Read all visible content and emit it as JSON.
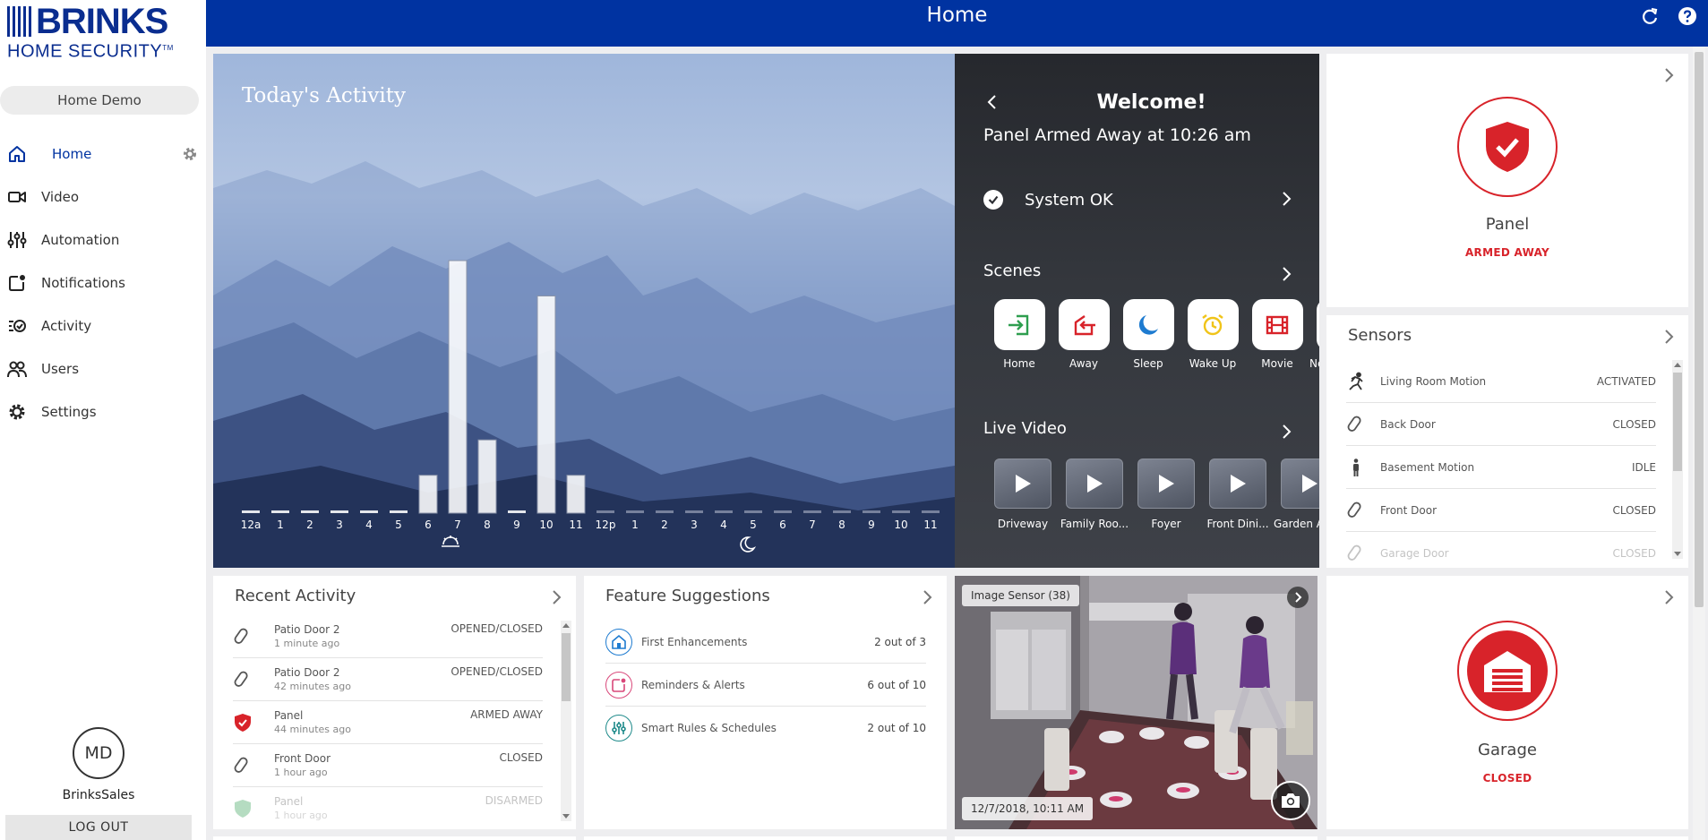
{
  "brand": {
    "line1": "BRINKS",
    "line2": "HOME SECURITY",
    "tm": "TM"
  },
  "account": "Home Demo",
  "nav": [
    {
      "label": "Home",
      "icon": "home-icon"
    },
    {
      "label": "Video",
      "icon": "video-camera-icon"
    },
    {
      "label": "Automation",
      "icon": "sliders-icon"
    },
    {
      "label": "Notifications",
      "icon": "notification-icon"
    },
    {
      "label": "Activity",
      "icon": "activity-icon"
    },
    {
      "label": "Users",
      "icon": "users-icon"
    },
    {
      "label": "Settings",
      "icon": "gear-icon"
    }
  ],
  "user": {
    "initials": "MD",
    "name": "BrinksSales",
    "logout": "LOG OUT"
  },
  "header": {
    "title": "Home"
  },
  "activity": {
    "title": "Today's Activity",
    "hours": [
      "12a",
      "1",
      "2",
      "3",
      "4",
      "5",
      "6",
      "7",
      "8",
      "9",
      "10",
      "11",
      "12p",
      "1",
      "2",
      "3",
      "4",
      "5",
      "6",
      "7",
      "8",
      "9",
      "10",
      "11"
    ],
    "levels": [
      0.01,
      0.01,
      0.01,
      0.01,
      0.01,
      0.01,
      0.15,
      1.0,
      0.29,
      0.01,
      0.86,
      0.15,
      0,
      0,
      0,
      0,
      0,
      0,
      0,
      0,
      0,
      0,
      0,
      0
    ],
    "current_hour_index": 11,
    "sunrise_icon": "sunrise-icon",
    "moon_icon": "moon-icon"
  },
  "welcome": {
    "title": "Welcome!",
    "subtitle": "Panel Armed Away at 10:26 am",
    "system": "System OK",
    "scenes_title": "Scenes",
    "scenes": [
      {
        "label": "Home",
        "icon": "arrive-home-icon",
        "color": "#2e9e4f"
      },
      {
        "label": "Away",
        "icon": "leave-home-icon",
        "color": "#d8232a"
      },
      {
        "label": "Sleep",
        "icon": "moon-icon",
        "color": "#1e7bd0"
      },
      {
        "label": "Wake Up",
        "icon": "alarm-clock-icon",
        "color": "#f0c419"
      },
      {
        "label": "Movie",
        "icon": "film-icon",
        "color": "#d8232a"
      },
      {
        "label": "Ne",
        "icon": "scene-icon",
        "color": "#888888"
      }
    ],
    "video_title": "Live Video",
    "videos": [
      "Driveway",
      "Family Roo...",
      "Foyer",
      "Front Dini...",
      "Garden A"
    ]
  },
  "panel": {
    "name": "Panel",
    "status": "ARMED AWAY"
  },
  "sensors": {
    "title": "Sensors",
    "items": [
      {
        "name": "Living Room Motion",
        "status": "ACTIVATED",
        "icon": "running-person-icon"
      },
      {
        "name": "Back Door",
        "status": "CLOSED",
        "icon": "contact-sensor-icon"
      },
      {
        "name": "Basement Motion",
        "status": "IDLE",
        "icon": "standing-person-icon"
      },
      {
        "name": "Front Door",
        "status": "CLOSED",
        "icon": "contact-sensor-icon"
      },
      {
        "name": "Garage Door",
        "status": "CLOSED",
        "icon": "contact-sensor-icon"
      }
    ]
  },
  "recent": {
    "title": "Recent Activity",
    "items": [
      {
        "name": "Patio Door 2",
        "time": "1 minute ago",
        "status": "OPENED/CLOSED",
        "icon": "contact-sensor-icon"
      },
      {
        "name": "Patio Door 2",
        "time": "42 minutes ago",
        "status": "OPENED/CLOSED",
        "icon": "contact-sensor-icon"
      },
      {
        "name": "Panel",
        "time": "44 minutes ago",
        "status": "ARMED AWAY",
        "icon": "shield-armed-icon"
      },
      {
        "name": "Front Door",
        "time": "1 hour ago",
        "status": "CLOSED",
        "icon": "contact-sensor-icon"
      },
      {
        "name": "Panel",
        "time": "1 hour ago",
        "status": "DISARMED",
        "icon": "shield-disarmed-icon"
      }
    ]
  },
  "features": {
    "title": "Feature Suggestions",
    "items": [
      {
        "name": "First Enhancements",
        "progress": "2 out of 3",
        "icon": "house-enhance-icon",
        "color": "#1e7bd0"
      },
      {
        "name": "Reminders & Alerts",
        "progress": "6 out of 10",
        "icon": "reminder-icon",
        "color": "#d9487a"
      },
      {
        "name": "Smart Rules & Schedules",
        "progress": "2 out of 10",
        "icon": "sliders-icon",
        "color": "#1e8a8a"
      }
    ]
  },
  "camera": {
    "label": "Image Sensor (38)",
    "timestamp": "12/7/2018, 10:11 AM"
  },
  "garage": {
    "name": "Garage",
    "status": "CLOSED"
  },
  "colors": {
    "brand_blue": "#0033a1",
    "alert_red": "#d8232a"
  }
}
